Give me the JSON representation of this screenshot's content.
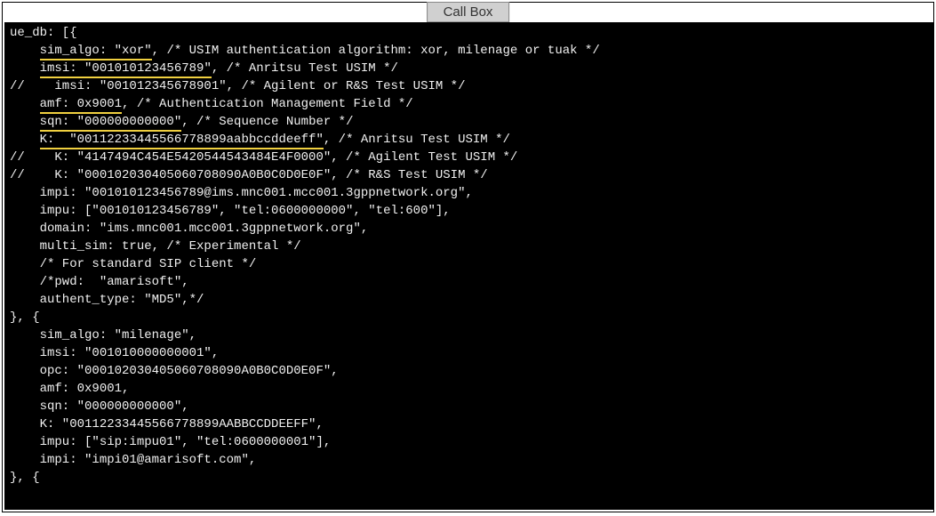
{
  "tab": {
    "label": "Call Box"
  },
  "code": {
    "l01": "ue_db: [{",
    "l02a": "    ",
    "l02b": "sim_algo: \"xor\"",
    "l02c": ", /* USIM authentication algorithm: xor, milenage or tuak */",
    "l03a": "    ",
    "l03b": "imsi: \"001010123456789\"",
    "l03c": ", /* Anritsu Test USIM */",
    "l04": "//    imsi: \"001012345678901\", /* Agilent or R&S Test USIM */",
    "l05a": "    ",
    "l05b": "amf: 0x9001",
    "l05c": ", /* Authentication Management Field */",
    "l06a": "    ",
    "l06b": "sqn: \"000000000000\"",
    "l06c": ", /* Sequence Number */",
    "l07a": "    ",
    "l07b": "K:  \"00112233445566778899aabbccddeeff\"",
    "l07c": ", /* Anritsu Test USIM */",
    "l08": "//    K: \"4147494C454E5420544543484E4F0000\", /* Agilent Test USIM */",
    "l09": "//    K: \"000102030405060708090A0B0C0D0E0F\", /* R&S Test USIM */",
    "l10": "",
    "l11": "    impi: \"001010123456789@ims.mnc001.mcc001.3gppnetwork.org\",",
    "l12": "    impu: [\"001010123456789\", \"tel:0600000000\", \"tel:600\"],",
    "l13": "    domain: \"ims.mnc001.mcc001.3gppnetwork.org\",",
    "l14": "    multi_sim: true, /* Experimental */",
    "l15": "",
    "l16": "    /* For standard SIP client */",
    "l17": "    /*pwd:  \"amarisoft\",",
    "l18": "    authent_type: \"MD5\",*/",
    "l19": "}, {",
    "l20": "    sim_algo: \"milenage\",",
    "l21": "    imsi: \"001010000000001\",",
    "l22": "    opc: \"000102030405060708090A0B0C0D0E0F\",",
    "l23": "    amf: 0x9001,",
    "l24": "    sqn: \"000000000000\",",
    "l25": "    K: \"00112233445566778899AABBCCDDEEFF\",",
    "l26": "    impu: [\"sip:impu01\", \"tel:0600000001\"],",
    "l27": "    impi: \"impi01@amarisoft.com\",",
    "l28": "}, {"
  }
}
